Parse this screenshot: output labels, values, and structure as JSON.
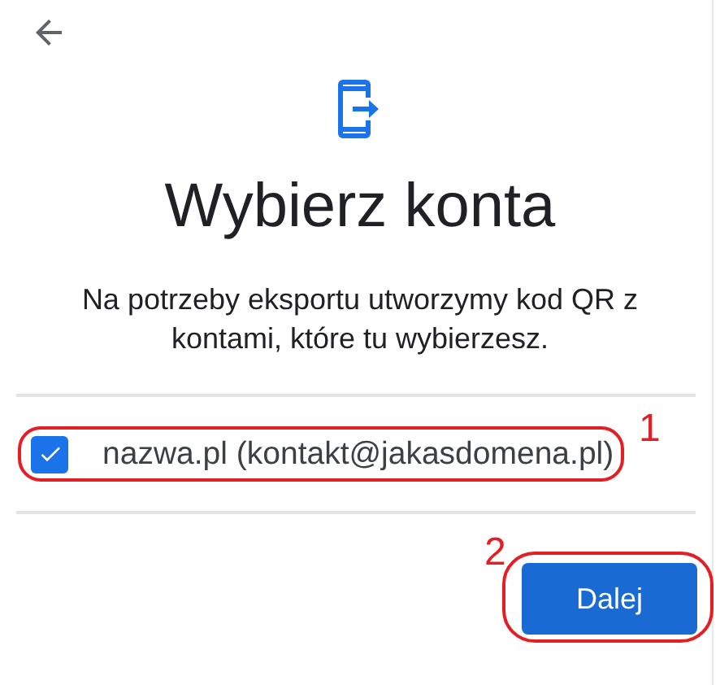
{
  "title": "Wybierz konta",
  "description": "Na potrzeby eksportu utworzymy kod QR z kontami, które tu wybierzesz.",
  "accounts": [
    {
      "label": "nazwa.pl (kontakt@jakasdomena.pl)",
      "checked": true,
      "callout": "1"
    }
  ],
  "next_button": {
    "label": "Dalej",
    "callout": "2"
  }
}
